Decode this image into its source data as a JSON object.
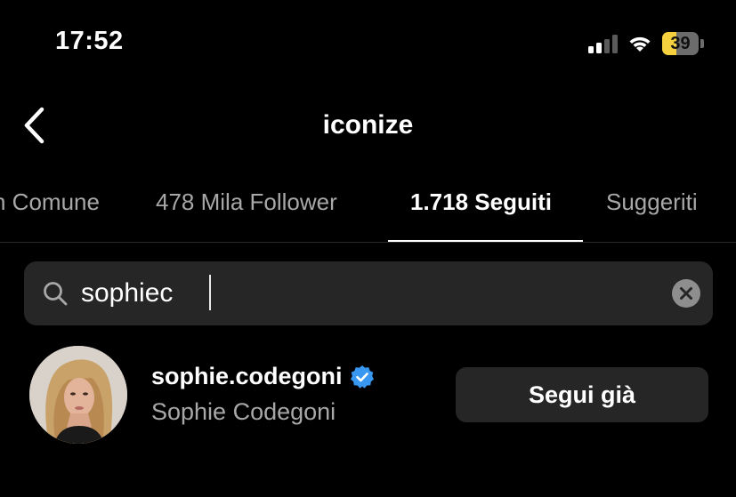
{
  "status_bar": {
    "time": "17:52",
    "battery_level": "39",
    "battery_fraction": 0.39,
    "signal_bars_active": 2,
    "signal_bars_total": 4,
    "icons": [
      "cellular-signal-icon",
      "wifi-icon",
      "battery-icon"
    ]
  },
  "header": {
    "title": "iconize",
    "back_icon": "chevron-left-icon"
  },
  "tabs": [
    {
      "label": "n Comune",
      "active": false
    },
    {
      "label": "478 Mila Follower",
      "active": false
    },
    {
      "label": "1.718 Seguiti",
      "active": true
    },
    {
      "label": "Suggeriti",
      "active": false
    }
  ],
  "search": {
    "value": "sophiec",
    "placeholder": "",
    "search_icon": "magnifier-icon",
    "clear_icon": "clear-circle-icon"
  },
  "results": [
    {
      "username": "sophie.codegoni",
      "full_name": "Sophie Codegoni",
      "verified": true,
      "button_label": "Segui già"
    }
  ],
  "colors": {
    "background": "#000000",
    "surface": "#262626",
    "text_primary": "#ffffff",
    "text_secondary": "#a8a8a8",
    "verified_blue": "#3897f0",
    "battery_low": "#f4d03f"
  }
}
